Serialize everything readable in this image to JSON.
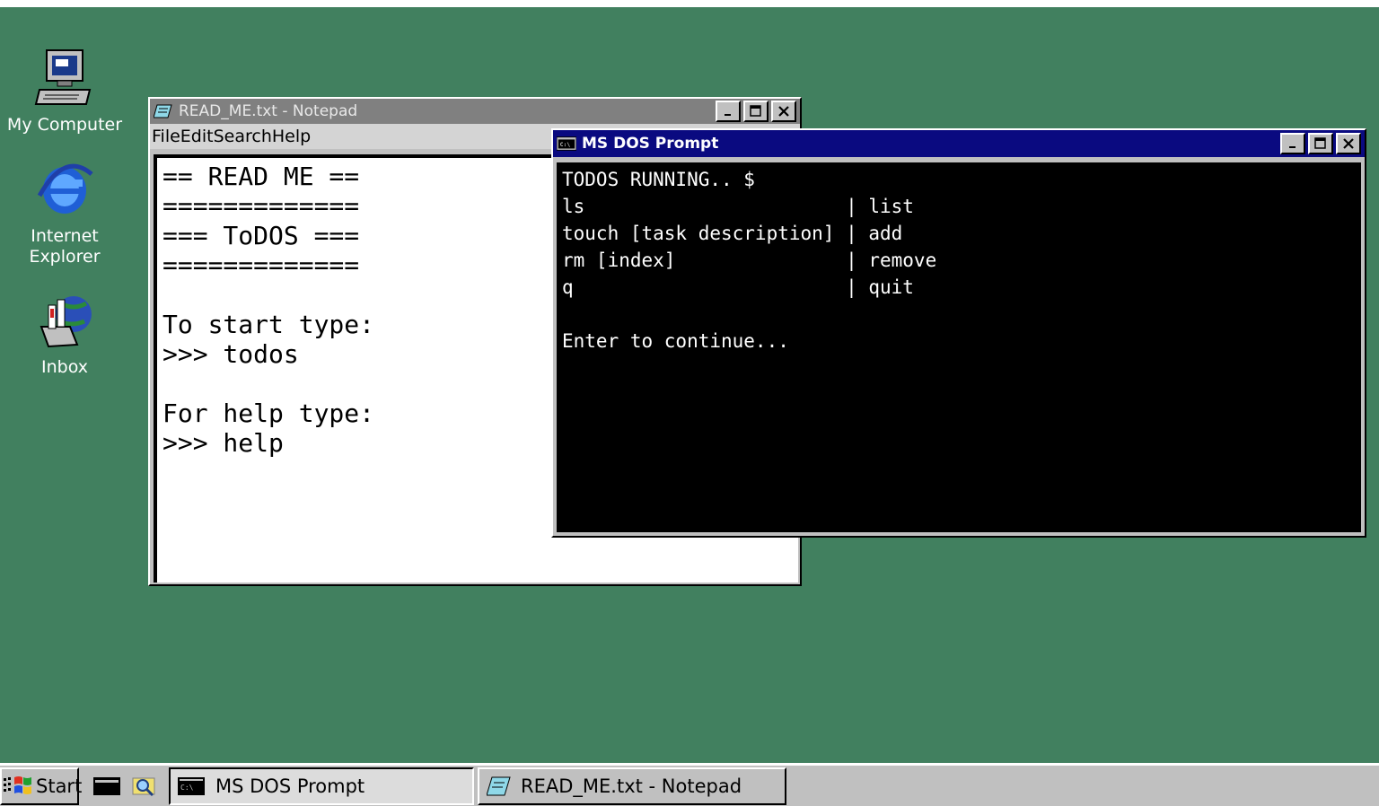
{
  "desktop": {
    "icons": [
      {
        "label": "My Computer",
        "icon": "my-computer-icon"
      },
      {
        "label": "Internet Explorer",
        "icon": "internet-explorer-icon"
      },
      {
        "label": "Inbox",
        "icon": "inbox-icon"
      }
    ],
    "background_color": "#41805f"
  },
  "notepad": {
    "title": "READ_ME.txt - Notepad",
    "menu": [
      "File",
      "Edit",
      "Search",
      "Help"
    ],
    "content": "== READ ME ==\n=============\n=== ToDOS ===\n=============\n\nTo start type:\n>>> todos\n\nFor help type:\n>>> help"
  },
  "dos": {
    "title": "MS DOS Prompt",
    "content": "TODOS RUNNING.. $\nls                       | list\ntouch [task description] | add\nrm [index]               | remove\nq                        | quit\n\nEnter to continue..."
  },
  "taskbar": {
    "start_label": "Start",
    "tasks": [
      {
        "label": "MS DOS Prompt",
        "active": true
      },
      {
        "label": "READ_ME.txt - Notepad",
        "active": false
      }
    ]
  }
}
